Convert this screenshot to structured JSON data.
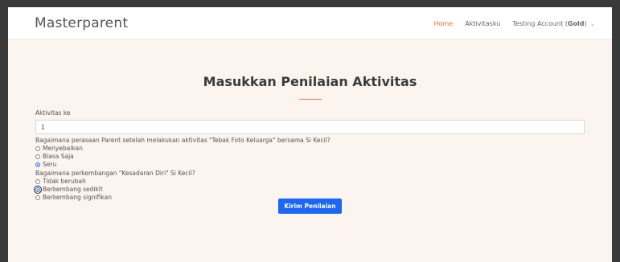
{
  "navbar": {
    "brand": "Masterparent",
    "home": "Home",
    "activities": "Aktivitasku",
    "account_prefix": "Testing Account (",
    "account_tier": "Gold",
    "account_suffix": ")"
  },
  "page": {
    "title": "Masukkan Penilaian Aktivitas"
  },
  "form": {
    "activity_label": "Aktivitas ke",
    "activity_value": "1",
    "q1": "Bagaimana perasaan Parent setelah melakukan aktivitas \"Tebak Foto Keluarga\" bersama Si Kecil?",
    "q1_options": [
      "Menyebalkan",
      "Biasa Saja",
      "Seru"
    ],
    "q2": "Bagaimana perkembangan \"Kesadaran Diri\" Si Kecil?",
    "q2_options": [
      "Tidak berubah",
      "Berkembang sedikit",
      "Berkembang signifikan"
    ],
    "submit": "Kirim Penilaian"
  },
  "colors": {
    "accent": "#f26b3a",
    "button": "#1a66f5"
  }
}
